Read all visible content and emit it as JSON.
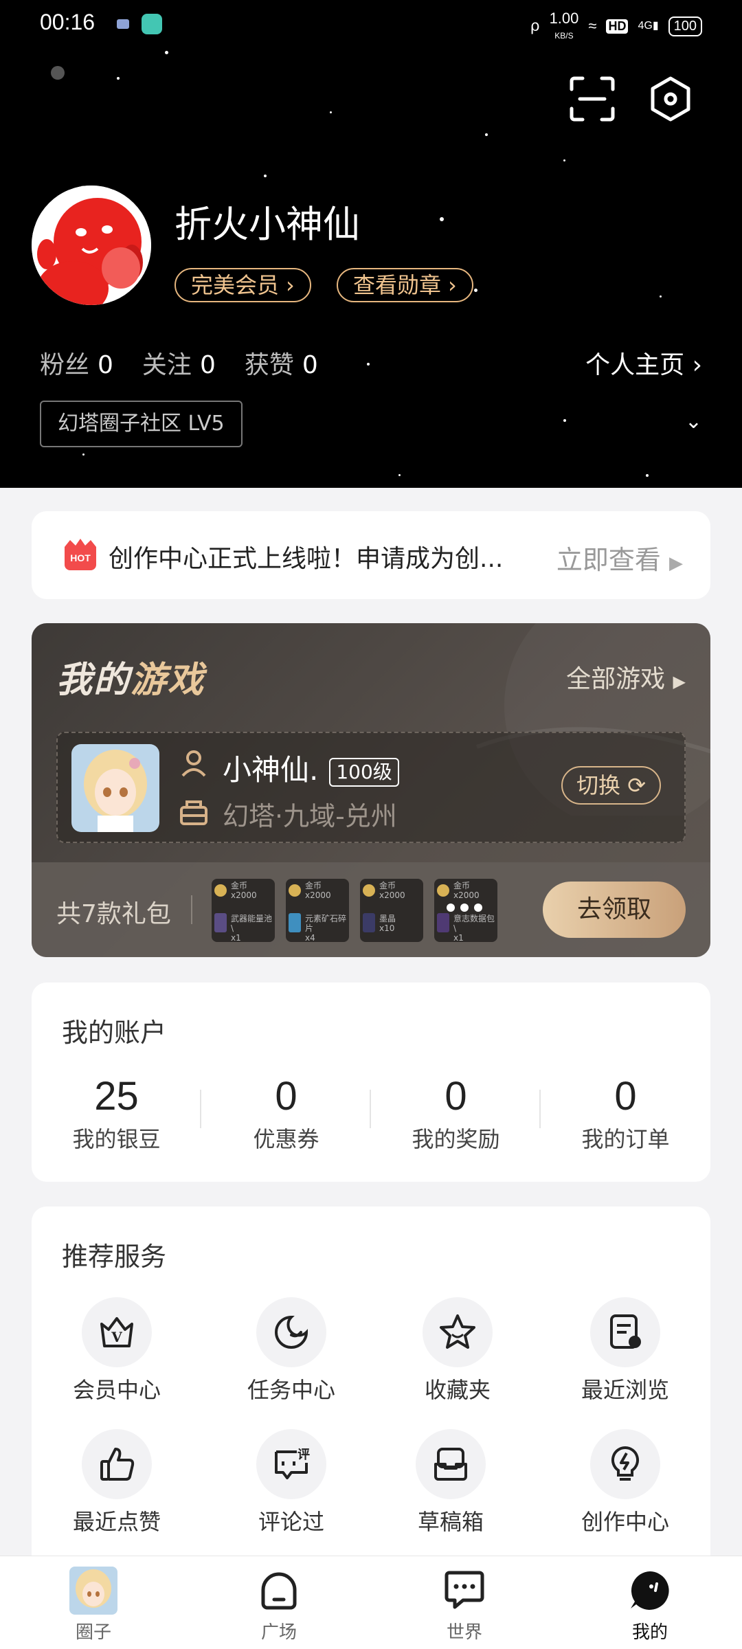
{
  "status_bar": {
    "time": "00:16",
    "net_speed": "1.00",
    "net_unit": "KB/S",
    "hd": "HD",
    "signal": "4G",
    "battery": "100"
  },
  "profile": {
    "username": "折火小神仙",
    "member_label": "完美会员",
    "badge_label": "查看勋章",
    "stats": [
      {
        "label": "粉丝",
        "value": "0"
      },
      {
        "label": "关注",
        "value": "0"
      },
      {
        "label": "获赞",
        "value": "0"
      }
    ],
    "homepage_label": "个人主页",
    "community_tag": "幻塔圈子社区 LV5"
  },
  "notice": {
    "hot": "HOT",
    "text": "创作中心正式上线啦！申请成为创...",
    "link": "立即查看"
  },
  "games": {
    "title_part1": "我的",
    "title_part2": "游戏",
    "all_label": "全部游戏",
    "character_name": "小神仙.",
    "level": "100级",
    "server": "幻塔·九域-兑州",
    "switch_label": "切换",
    "gift_count": "共7款礼包",
    "gifts": [
      {
        "coin": "金币",
        "coin_qty": "x2000",
        "item": "武器能量池\\",
        "item_qty": "x1"
      },
      {
        "coin": "金币",
        "coin_qty": "x2000",
        "item": "元素矿石碎片",
        "item_qty": "x4"
      },
      {
        "coin": "金币",
        "coin_qty": "x2000",
        "item": "墨晶",
        "item_qty": "x10"
      },
      {
        "coin": "金币",
        "coin_qty": "x2000",
        "item": "意志数据包\\",
        "item_qty": "x1"
      }
    ],
    "claim_label": "去领取"
  },
  "account": {
    "title": "我的账户",
    "items": [
      {
        "value": "25",
        "label": "我的银豆"
      },
      {
        "value": "0",
        "label": "优惠券"
      },
      {
        "value": "0",
        "label": "我的奖励"
      },
      {
        "value": "0",
        "label": "我的订单"
      }
    ]
  },
  "services": {
    "title": "推荐服务",
    "items": [
      {
        "label": "会员中心",
        "icon": "vip-crown-icon"
      },
      {
        "label": "任务中心",
        "icon": "task-icon"
      },
      {
        "label": "收藏夹",
        "icon": "star-icon"
      },
      {
        "label": "最近浏览",
        "icon": "history-icon"
      },
      {
        "label": "最近点赞",
        "icon": "thumb-up-icon"
      },
      {
        "label": "评论过",
        "icon": "comment-icon",
        "glyph": "评"
      },
      {
        "label": "草稿箱",
        "icon": "draft-box-icon"
      },
      {
        "label": "创作中心",
        "icon": "bulb-icon"
      }
    ]
  },
  "tabs": [
    {
      "label": "圈子"
    },
    {
      "label": "广场"
    },
    {
      "label": "世界"
    },
    {
      "label": "我的"
    }
  ],
  "colors": {
    "gold": "#e7b77f",
    "header_bg": "#000000",
    "page_bg": "#f3f3f5",
    "hot_red": "#f24b4b"
  }
}
